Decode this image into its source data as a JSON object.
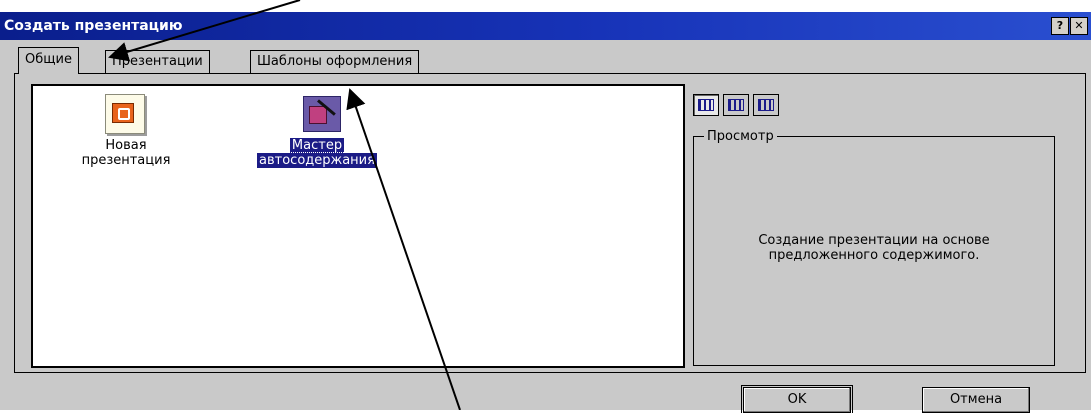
{
  "window": {
    "title": "Создать презентацию",
    "help_button": "?",
    "close_button": "✕"
  },
  "tabs": [
    {
      "label": "Общие",
      "active": true
    },
    {
      "label": "Презентации",
      "active": false
    },
    {
      "label": "Шаблоны оформления",
      "active": false
    }
  ],
  "list": {
    "items": [
      {
        "line1": "Новая",
        "line2": "презентация",
        "icon": "new-presentation-icon",
        "selected": false
      },
      {
        "line1": "Мастер",
        "line2": "автосодержания",
        "icon": "autocontent-wizard-icon",
        "selected": true
      }
    ]
  },
  "view_buttons": [
    {
      "icon": "large-icons-view-icon"
    },
    {
      "icon": "list-view-icon"
    },
    {
      "icon": "details-view-icon"
    }
  ],
  "preview": {
    "legend": "Просмотр",
    "description_line1": "Создание презентации на основе",
    "description_line2": "предложенного содержимого."
  },
  "buttons": {
    "ok": "OK",
    "cancel": "Отмена"
  },
  "colors": {
    "title_bar": "#0a1e8c",
    "selection": "#1b1b86",
    "dialog_face": "#c9c9c9"
  }
}
